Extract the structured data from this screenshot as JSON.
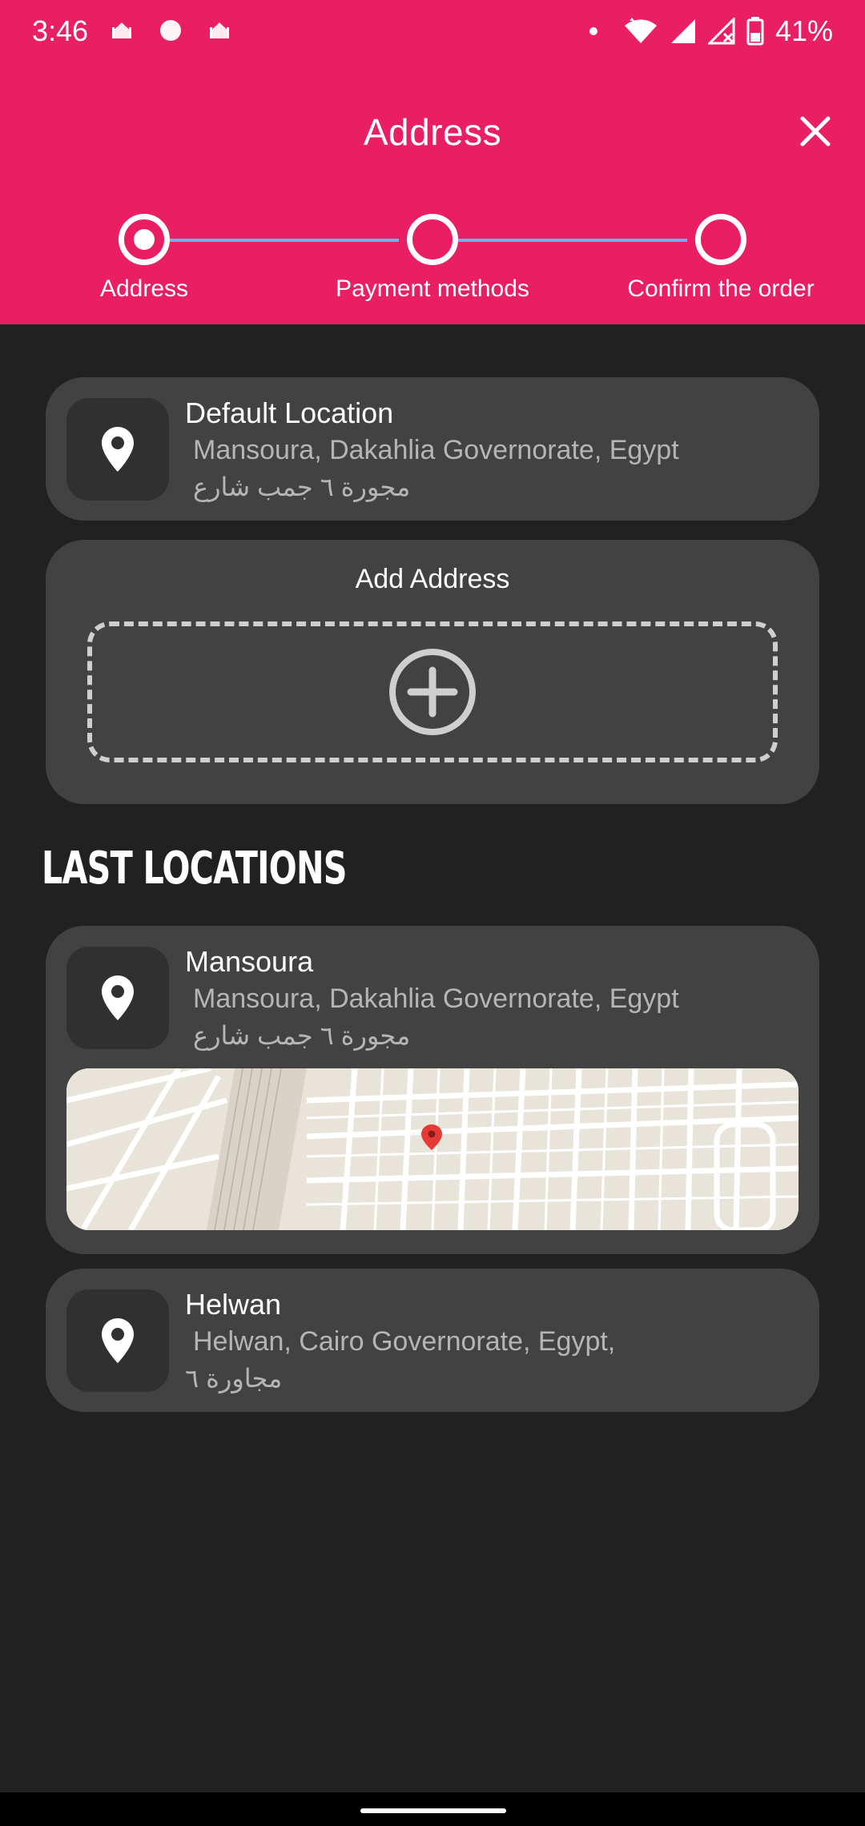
{
  "status_bar": {
    "time": "3:46",
    "battery": "41%",
    "icons": [
      "mosque-icon",
      "circle-icon",
      "mosque-icon",
      "dot-icon",
      "wifi-icon",
      "signal-icon",
      "signal-icon",
      "battery-icon"
    ]
  },
  "header": {
    "title": "Address",
    "close_icon": "close-icon",
    "background": "#e91e63"
  },
  "stepper": {
    "steps": [
      {
        "label": "Address",
        "active": true
      },
      {
        "label": "Payment methods",
        "active": false
      },
      {
        "label": "Confirm the order",
        "active": false
      }
    ],
    "line_color": "#64b5f6"
  },
  "default_location": {
    "name": "Default Location",
    "address": "Mansoura, Dakahlia Governorate, Egypt",
    "street": "مجورة ٦ جمب شارع"
  },
  "add_address": {
    "title": "Add Address",
    "icon": "add-circle-icon"
  },
  "last_locations": {
    "title": "LAST LOCATIONS",
    "items": [
      {
        "name": "Mansoura",
        "address": "Mansoura, Dakahlia Governorate, Egypt",
        "street": "مجورة ٦ جمب شارع",
        "has_map": true
      },
      {
        "name": "Helwan",
        "address": "Helwan, Cairo Governorate, Egypt,",
        "street": "مجاورة ٦",
        "has_map": false
      }
    ]
  }
}
